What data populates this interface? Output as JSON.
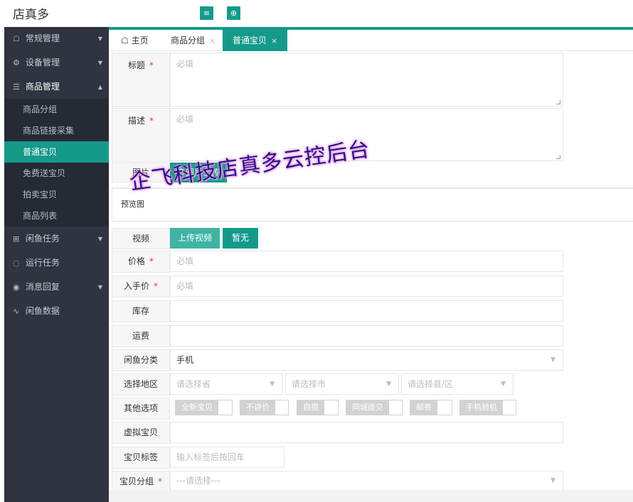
{
  "app": {
    "brand": "店真多",
    "menu_icon": "≡",
    "add_icon": "⊕"
  },
  "colors": {
    "accent": "#159a8a",
    "sidebar": "#2f3440",
    "required": "#e4393c"
  },
  "sidebar": {
    "groups": [
      {
        "label": "常规管理",
        "icon": "home-icon",
        "glyph": "☖"
      },
      {
        "label": "设备管理",
        "icon": "gear-icon",
        "glyph": "⚙"
      },
      {
        "label": "商品管理",
        "icon": "list-icon",
        "glyph": "☰"
      }
    ],
    "sub_items": [
      "商品分组",
      "商品链接采集",
      "普通宝贝",
      "免费送宝贝",
      "拍卖宝贝",
      "商品列表"
    ],
    "groups2": [
      {
        "label": "闲鱼任务",
        "icon": "grid-icon",
        "glyph": "⊞"
      },
      {
        "label": "运行任务",
        "icon": "spinner-icon",
        "glyph": "◌"
      },
      {
        "label": "消息回复",
        "icon": "eye-icon",
        "glyph": "◉"
      },
      {
        "label": "闲鱼数据",
        "icon": "pulse-icon",
        "glyph": "∿"
      }
    ]
  },
  "tabs": {
    "home": "主页",
    "home_glyph": "☖",
    "group": "商品分组",
    "active": "普通宝贝",
    "close": "×"
  },
  "form": {
    "title_label": "标题",
    "title_placeholder": "必填",
    "desc_label": "描述",
    "desc_placeholder": "必填",
    "image_label": "图片",
    "image_button": "多图片上传",
    "preview_label": "预览图",
    "video_label": "视频",
    "video_upload": "上传视频",
    "video_none": "暂无",
    "price_label": "价格",
    "price_placeholder": "必填",
    "cost_label": "入手价",
    "cost_placeholder": "必填",
    "stock_label": "库存",
    "shipping_label": "运费",
    "category_label": "闲鱼分类",
    "category_value": "手机",
    "region_label": "选择地区",
    "province": "请选择省",
    "city": "请选择市",
    "district": "请选择县/区",
    "options_label": "其他选项",
    "options": [
      "全新宝贝",
      "不讲价",
      "自提",
      "同城面交",
      "邮寄",
      "手机验机"
    ],
    "virtual_label": "虚拟宝贝",
    "tags_label": "宝贝标签",
    "tags_placeholder": "输入标签后按回车",
    "group_label": "宝贝分组",
    "group_value": "---请选择---",
    "required_mark": "*",
    "dropdown_arrow": "▼"
  },
  "watermark": "企飞科技店真多云控后台"
}
